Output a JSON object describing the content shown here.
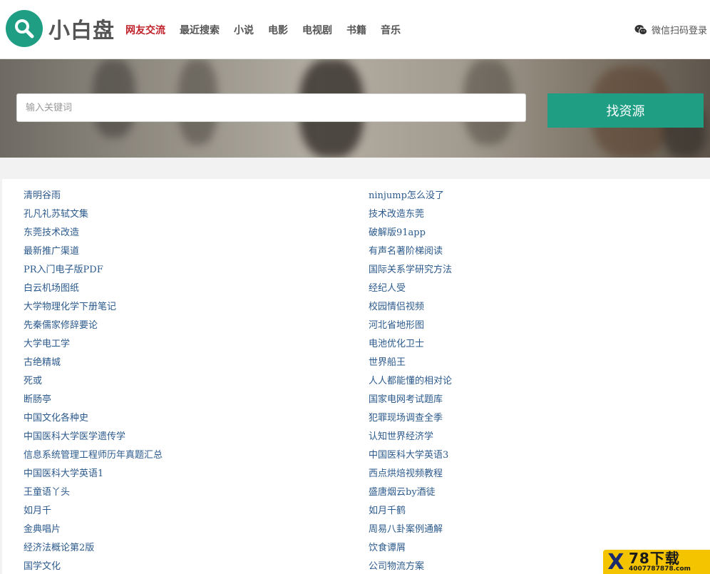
{
  "header": {
    "logo_text": "小白盘",
    "nav": [
      {
        "label": "网友交流",
        "active": true
      },
      {
        "label": "最近搜索",
        "active": false
      },
      {
        "label": "小说",
        "active": false
      },
      {
        "label": "电影",
        "active": false
      },
      {
        "label": "电视剧",
        "active": false
      },
      {
        "label": "书籍",
        "active": false
      },
      {
        "label": "音乐",
        "active": false
      }
    ],
    "wechat_login": "微信扫码登录"
  },
  "search": {
    "placeholder": "输入关键词",
    "value": "",
    "button_label": "找资源"
  },
  "links": {
    "left": [
      "清明谷雨",
      "孔凡礼苏轼文集",
      "东莞技术改造",
      "最新推广渠道",
      "PR入门电子版PDF",
      "白云机场图纸",
      "大学物理化学下册笔记",
      "先秦儒家修辞要论",
      "大学电工学",
      "古绝精城",
      "死或",
      "断肠亭",
      "中国文化各种史",
      "中国医科大学医学遗传学",
      "信息系统管理工程师历年真题汇总",
      "中国医科大学英语1",
      "王童语丫头",
      "如月千",
      "金典唱片",
      "经济法概论第2版",
      "国学文化"
    ],
    "right": [
      "ninjump怎么没了",
      "技术改造东莞",
      "破解版91app",
      "有声名著阶梯阅读",
      "国际关系学研究方法",
      "经纪人受",
      "校园情侣视频",
      "河北省地形图",
      "电池优化卫士",
      "世界船王",
      "人人都能懂的相对论",
      "国家电网考试题库",
      "犯罪现场调查全季",
      "认知世界经济学",
      "中国医科大学英语3",
      "西点烘焙视频教程",
      "盛唐烟云by酒徒",
      "如月千鹤",
      "周易八卦案例通解",
      "饮食谭屑",
      "公司物流方案"
    ]
  },
  "watermark": {
    "mark": "X",
    "title": "78下载",
    "url": "4007787878.com"
  },
  "colors": {
    "brand": "#1f9e84",
    "nav_active": "#c0212a",
    "link": "#2c5a8c"
  },
  "icons": {
    "logo": "search-icon",
    "wechat": "wechat-icon"
  }
}
